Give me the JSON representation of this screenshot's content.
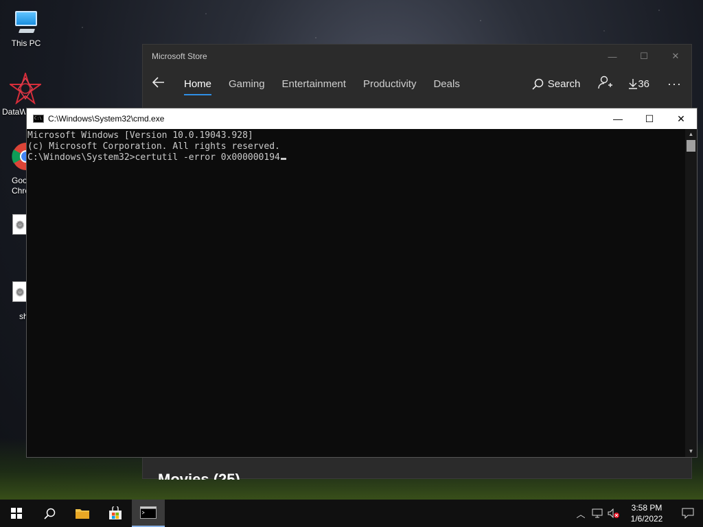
{
  "desktop": {
    "icons": [
      {
        "label": "This PC",
        "icon": "this-pc-icon"
      },
      {
        "label": "DataW",
        "icon": "datawrapper-icon"
      },
      {
        "label": "Goo Chro",
        "icon": "chrome-icon"
      },
      {
        "label": "",
        "icon": "settings-file-icon"
      },
      {
        "label": "sh",
        "icon": "settings-file-icon"
      }
    ]
  },
  "store": {
    "title": "Microsoft Store",
    "tabs": [
      {
        "label": "Home",
        "active": true
      },
      {
        "label": "Gaming",
        "active": false
      },
      {
        "label": "Entertainment",
        "active": false
      },
      {
        "label": "Productivity",
        "active": false
      },
      {
        "label": "Deals",
        "active": false
      }
    ],
    "search_label": "Search",
    "downloads_count": "36",
    "bottom_heading": "Movies (25)"
  },
  "cmd": {
    "title": "C:\\Windows\\System32\\cmd.exe",
    "lines": [
      "Microsoft Windows [Version 10.0.19043.928]",
      "(c) Microsoft Corporation. All rights reserved.",
      "",
      "C:\\Windows\\System32>certutil -error 0x000000194"
    ]
  },
  "taskbar": {
    "time": "3:58 PM",
    "date": "1/6/2022"
  },
  "colors": {
    "accent": "#2f8fe6",
    "store_bg": "#2b2b2b",
    "console_bg": "#0c0c0c",
    "console_fg": "#cccccc",
    "taskbar_bg": "#101010"
  }
}
